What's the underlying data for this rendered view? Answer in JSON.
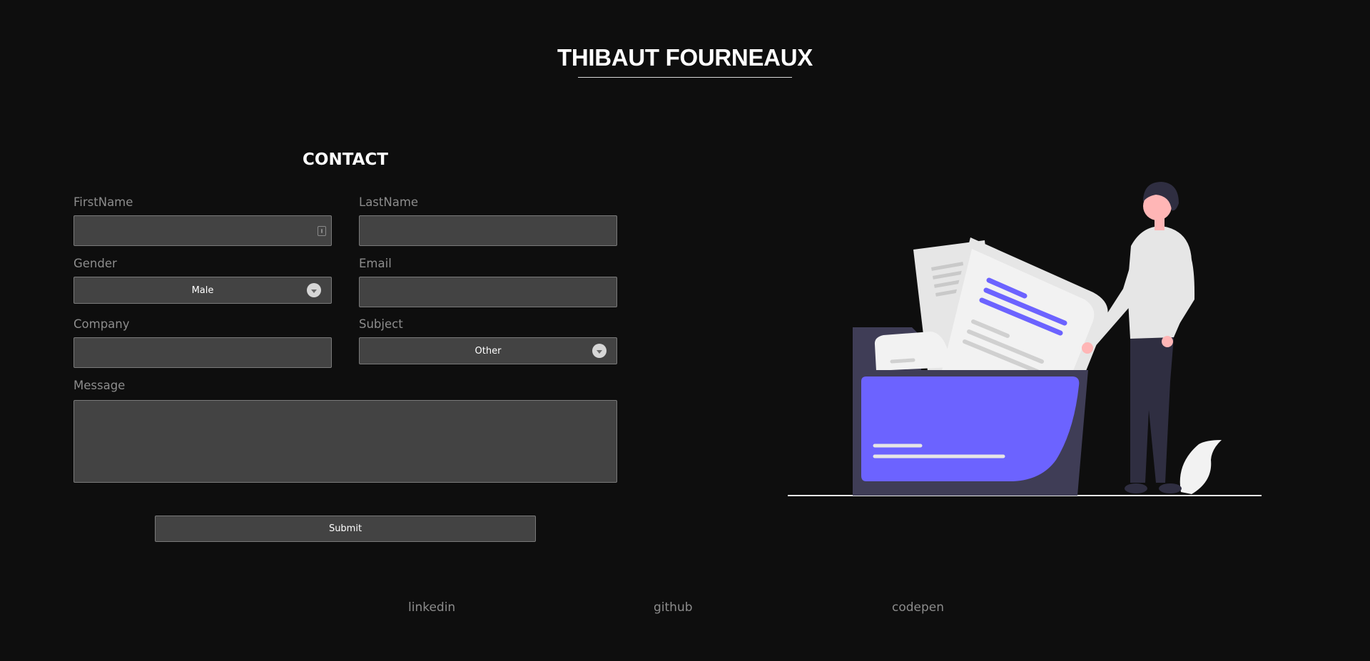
{
  "header": {
    "title": "THIBAUT FOURNEAUX"
  },
  "contact": {
    "heading": "CONTACT",
    "fields": {
      "firstname": {
        "label": "FirstName",
        "value": "",
        "placeholder": ""
      },
      "lastname": {
        "label": "LastName",
        "value": "",
        "placeholder": ""
      },
      "gender": {
        "label": "Gender",
        "selected": "Male"
      },
      "email": {
        "label": "Email",
        "value": "",
        "placeholder": ""
      },
      "company": {
        "label": "Company",
        "value": "",
        "placeholder": ""
      },
      "subject": {
        "label": "Subject",
        "selected": "Other"
      },
      "message": {
        "label": "Message",
        "value": "",
        "placeholder": ""
      }
    },
    "submit_label": "Submit"
  },
  "footer": {
    "links": [
      {
        "label": "linkedin"
      },
      {
        "label": "github"
      },
      {
        "label": "codepen"
      }
    ]
  },
  "colors": {
    "background": "#0e0e0e",
    "input_bg": "#434343",
    "accent": "#6c63ff",
    "folder_dark": "#3f3d56"
  },
  "icons": {
    "autofill": "contact-card-icon",
    "select_arrow": "chevron-down-icon"
  }
}
